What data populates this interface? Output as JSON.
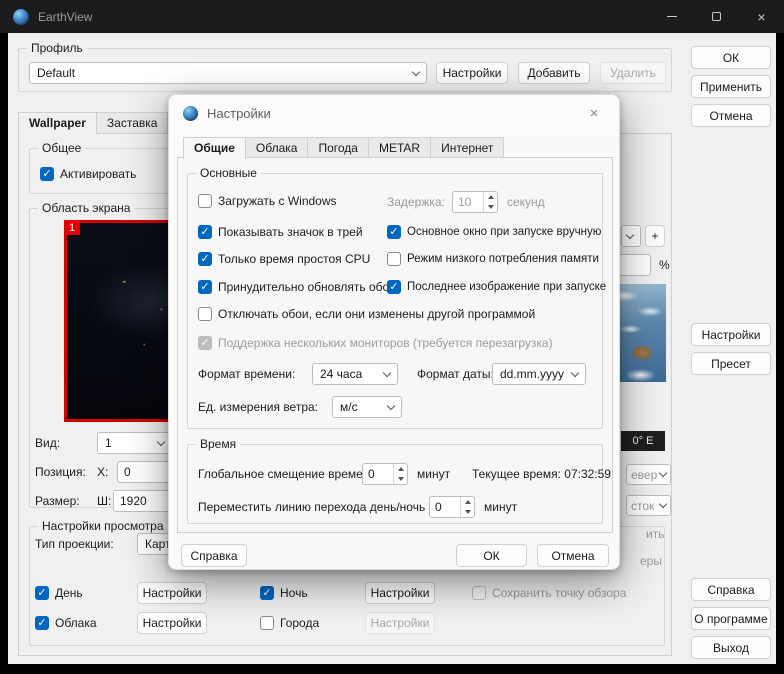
{
  "window": {
    "title": "EarthView"
  },
  "profile": {
    "label": "Профиль",
    "value": "Default",
    "settings": "Настройки",
    "add": "Добавить",
    "remove": "Удалить"
  },
  "side": {
    "ok": "ОК",
    "apply": "Применить",
    "cancel": "Отмена",
    "settings": "Настройки",
    "preset": "Пресет",
    "help": "Справка",
    "about": "О программе",
    "exit": "Выход"
  },
  "tabs": {
    "wallpaper": "Wallpaper",
    "screensaver": "Заставка"
  },
  "general": {
    "label": "Общее",
    "activate": "Активировать"
  },
  "area": {
    "label": "Область экрана",
    "badge": "1"
  },
  "rows": {
    "view_label": "Вид:",
    "view_value": "1",
    "pos_label": "Позиция:",
    "pos_x": "X:",
    "pos_x_value": "0",
    "size_label": "Размер:",
    "size_w": "Ш:",
    "size_w_value": "1920"
  },
  "viewcfg": {
    "label": "Настройки просмотра",
    "projection": "Тип проекции:",
    "projection_value": "Карт",
    "day": "День",
    "night": "Ночь",
    "clouds": "Облака",
    "cities": "Города",
    "btn": "Настройки",
    "save_viewpoint": "Сохранить точку обзора"
  },
  "fragments": {
    "plus": "+",
    "percent": "%",
    "coord": "0° E",
    "north_part": "евер",
    "east_part": "сток",
    "part1": "ить",
    "part2": "еры"
  },
  "checks": {
    "activate": true,
    "day": true,
    "night": true,
    "clouds": true,
    "cities": false,
    "save_viewpoint": false,
    "load_windows": false,
    "tray": true,
    "main_manual": true,
    "cpu_idle": true,
    "low_mem": false,
    "force_update": true,
    "last_image": true,
    "disable_changed": false,
    "multimon": true
  },
  "dlg": {
    "title": "Настройки",
    "tabs": [
      "Общие",
      "Облака",
      "Погода",
      "METAR",
      "Интернет"
    ],
    "basic": {
      "label": "Основные",
      "load_windows": "Загружать с Windows",
      "delay_label": "Задержка:",
      "delay_value": "10",
      "seconds": "секунд",
      "tray": "Показывать значок в трей",
      "main_manual": "Основное окно при запуске вручную",
      "cpu_idle": "Только время простоя CPU",
      "low_mem": "Режим низкого потребления памяти",
      "force_update": "Принудительно обновлять обои",
      "last_image": "Последнее изображение при запуске",
      "disable_changed": "Отключать обои, если они изменены другой программой",
      "multimon": "Поддержка нескольких мониторов (требуется перезагрузка)",
      "time_format_label": "Формат времени:",
      "time_format_value": "24 часа",
      "date_format_label": "Формат даты:",
      "date_format_value": "dd.mm.yyyy",
      "wind_label": "Ед. измерения ветра:",
      "wind_value": "м/с"
    },
    "time": {
      "label": "Время",
      "offset_label": "Глобальное смещение времени:",
      "offset_value": "0",
      "minutes": "минут",
      "current": "Текущее время: 07:32:59",
      "move_label": "Переместить линию перехода день/ночь на:",
      "move_value": "0"
    },
    "footer": {
      "help": "Справка",
      "ok": "ОК",
      "cancel": "Отмена"
    }
  }
}
